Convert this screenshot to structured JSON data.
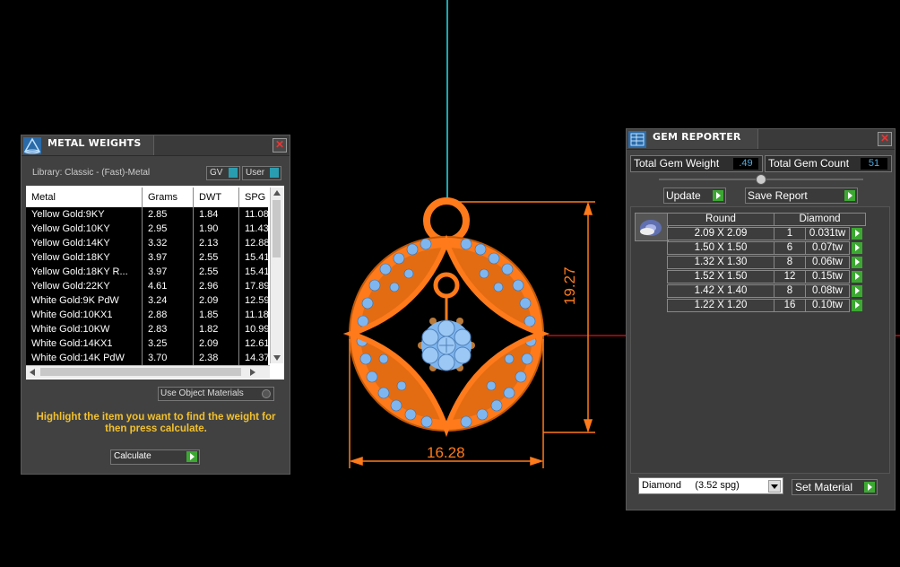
{
  "viewport": {
    "dimension_width": "16.28",
    "dimension_height": "19.27",
    "accent_color": "#ff7a1a"
  },
  "metal_weights": {
    "title": "METAL WEIGHTS",
    "close_glyph": "✕",
    "library_label": "Library: Classic - (Fast)-Metal",
    "gv_label": "GV",
    "user_label": "User",
    "columns": [
      "Metal",
      "Grams",
      "DWT",
      "SPG"
    ],
    "rows": [
      [
        "Yellow Gold:9KY",
        "2.85",
        "1.84",
        "11.08"
      ],
      [
        "Yellow Gold:10KY",
        "2.95",
        "1.90",
        "11.43"
      ],
      [
        "Yellow Gold:14KY",
        "3.32",
        "2.13",
        "12.88"
      ],
      [
        "Yellow Gold:18KY",
        "3.97",
        "2.55",
        "15.41"
      ],
      [
        "Yellow Gold:18KY R...",
        "3.97",
        "2.55",
        "15.41"
      ],
      [
        "Yellow Gold:22KY",
        "4.61",
        "2.96",
        "17.89"
      ],
      [
        "White Gold:9K PdW",
        "3.24",
        "2.09",
        "12.59"
      ],
      [
        "White Gold:10KX1",
        "2.88",
        "1.85",
        "11.18"
      ],
      [
        "White Gold:10KW",
        "2.83",
        "1.82",
        "10.99"
      ],
      [
        "White Gold:14KX1",
        "3.25",
        "2.09",
        "12.61"
      ],
      [
        "White Gold:14K PdW",
        "3.70",
        "2.38",
        "14.37"
      ]
    ],
    "use_object_materials": "Use Object Materials",
    "instruction": "Highlight the item you want to find the weight for then press calculate.",
    "calculate_label": "Calculate"
  },
  "gem_reporter": {
    "title": "GEM REPORTER",
    "close_glyph": "✕",
    "total_weight_label": "Total Gem Weight",
    "total_weight_value": ".49",
    "total_count_label": "Total Gem Count",
    "total_count_value": "51",
    "update_label": "Update",
    "save_report_label": "Save Report",
    "shape_header": "Round",
    "material_header": "Diamond",
    "gems": [
      {
        "size": "2.09 X 2.09",
        "count": "1",
        "weight": "0.031tw"
      },
      {
        "size": "1.50 X 1.50",
        "count": "6",
        "weight": "0.07tw"
      },
      {
        "size": "1.32 X 1.30",
        "count": "8",
        "weight": "0.06tw"
      },
      {
        "size": "1.52 X 1.50",
        "count": "12",
        "weight": "0.15tw"
      },
      {
        "size": "1.42 X 1.40",
        "count": "8",
        "weight": "0.08tw"
      },
      {
        "size": "1.22 X 1.20",
        "count": "16",
        "weight": "0.10tw"
      }
    ],
    "material_select": "Diamond     (3.52 spg)",
    "set_material_label": "Set Material"
  }
}
